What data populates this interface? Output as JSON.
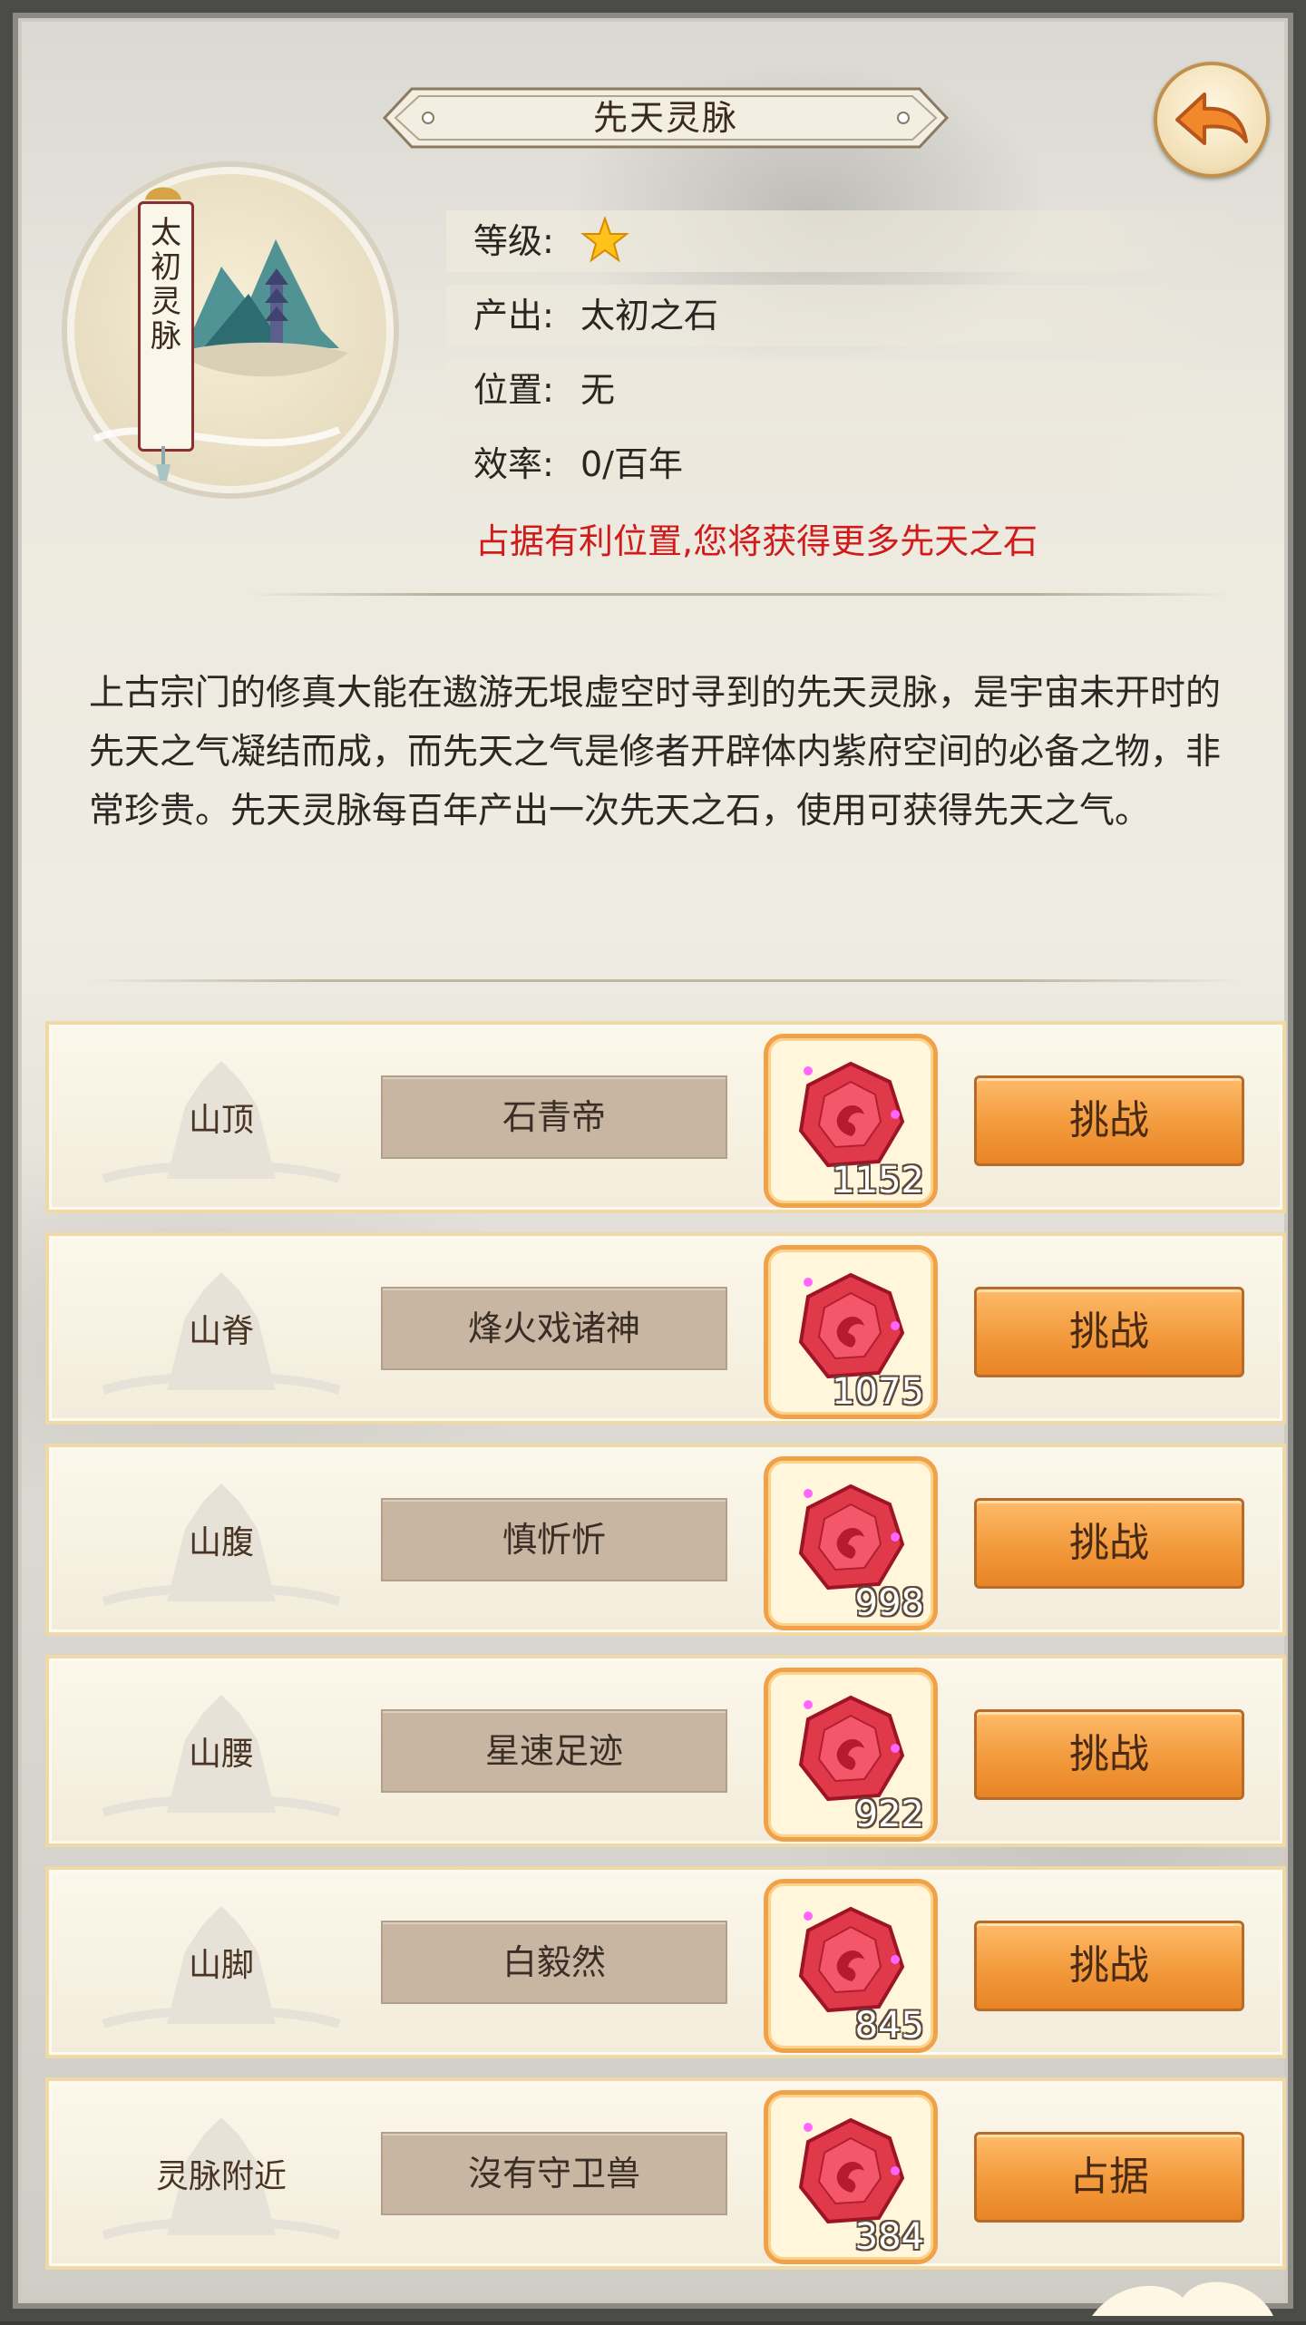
{
  "header": {
    "title": "先天灵脉"
  },
  "emblem": {
    "name": "太初灵脉"
  },
  "info": {
    "level_label": "等级:",
    "level_stars": 1,
    "output_label": "产出:",
    "output_value": "太初之石",
    "position_label": "位置:",
    "position_value": "无",
    "efficiency_label": "效率:",
    "efficiency_value": "0/百年",
    "hint": "占据有利位置,您将获得更多先天之石"
  },
  "description": "上古宗门的修真大能在遨游无垠虚空时寻到的先天灵脉，是宇宙未开时的先天之气凝结而成，而先天之气是修者开辟体内紫府空间的必备之物，非常珍贵。先天灵脉每百年产出一次先天之石，使用可获得先天之气。",
  "rows": [
    {
      "spot": "山顶",
      "guardian": "石青帝",
      "reward": "1152",
      "action": "挑战"
    },
    {
      "spot": "山脊",
      "guardian": "烽火戏诸神",
      "reward": "1075",
      "action": "挑战"
    },
    {
      "spot": "山腹",
      "guardian": "慎忻忻",
      "reward": "998",
      "action": "挑战"
    },
    {
      "spot": "山腰",
      "guardian": "星速足迹",
      "reward": "922",
      "action": "挑战"
    },
    {
      "spot": "山脚",
      "guardian": "白毅然",
      "reward": "845",
      "action": "挑战"
    },
    {
      "spot": "灵脉附近",
      "guardian": "沒有守卫兽",
      "reward": "384",
      "action": "占据"
    }
  ],
  "colors": {
    "hint_red": "#d11a1a",
    "action_orange": "#f29a3c",
    "reward_border": "#f0a24a",
    "guardian_bg": "#c8b6a2"
  },
  "icons": {
    "back": "back-arrow-icon",
    "star": "star-icon",
    "reward": "red-gem-icon"
  }
}
